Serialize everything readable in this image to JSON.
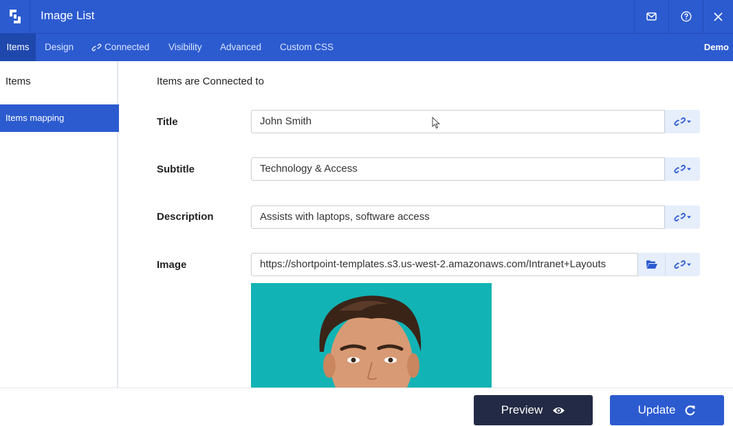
{
  "app": {
    "title": "Image List"
  },
  "header": {
    "logo_icon": "shortpoint-logo-icon",
    "actions": [
      {
        "icon": "mail-icon"
      },
      {
        "icon": "help-icon"
      },
      {
        "icon": "close-icon"
      }
    ]
  },
  "tabs": [
    {
      "label": "Items",
      "active": true
    },
    {
      "label": "Design"
    },
    {
      "label": "Connected",
      "icon": "link-icon"
    },
    {
      "label": "Visibility"
    },
    {
      "label": "Advanced"
    },
    {
      "label": "Custom CSS"
    }
  ],
  "tab_right": "Demo",
  "sidebar": {
    "title": "Items",
    "items": [
      {
        "label": "Items mapping",
        "active": true
      }
    ]
  },
  "main": {
    "section_title": "Items are Connected to",
    "fields": [
      {
        "label": "Title",
        "value": "John Smith"
      },
      {
        "label": "Subtitle",
        "value": "Technology & Access"
      },
      {
        "label": "Description",
        "value": "Assists with laptops, software access"
      },
      {
        "label": "Image",
        "value": "https://shortpoint-templates.s3.us-west-2.amazonaws.com/Intranet+Layouts"
      }
    ]
  },
  "footer": {
    "preview_label": "Preview",
    "update_label": "Update"
  },
  "colors": {
    "primary": "#2c5bd0",
    "dark": "#232a45",
    "image_bg": "#12b3b5"
  }
}
